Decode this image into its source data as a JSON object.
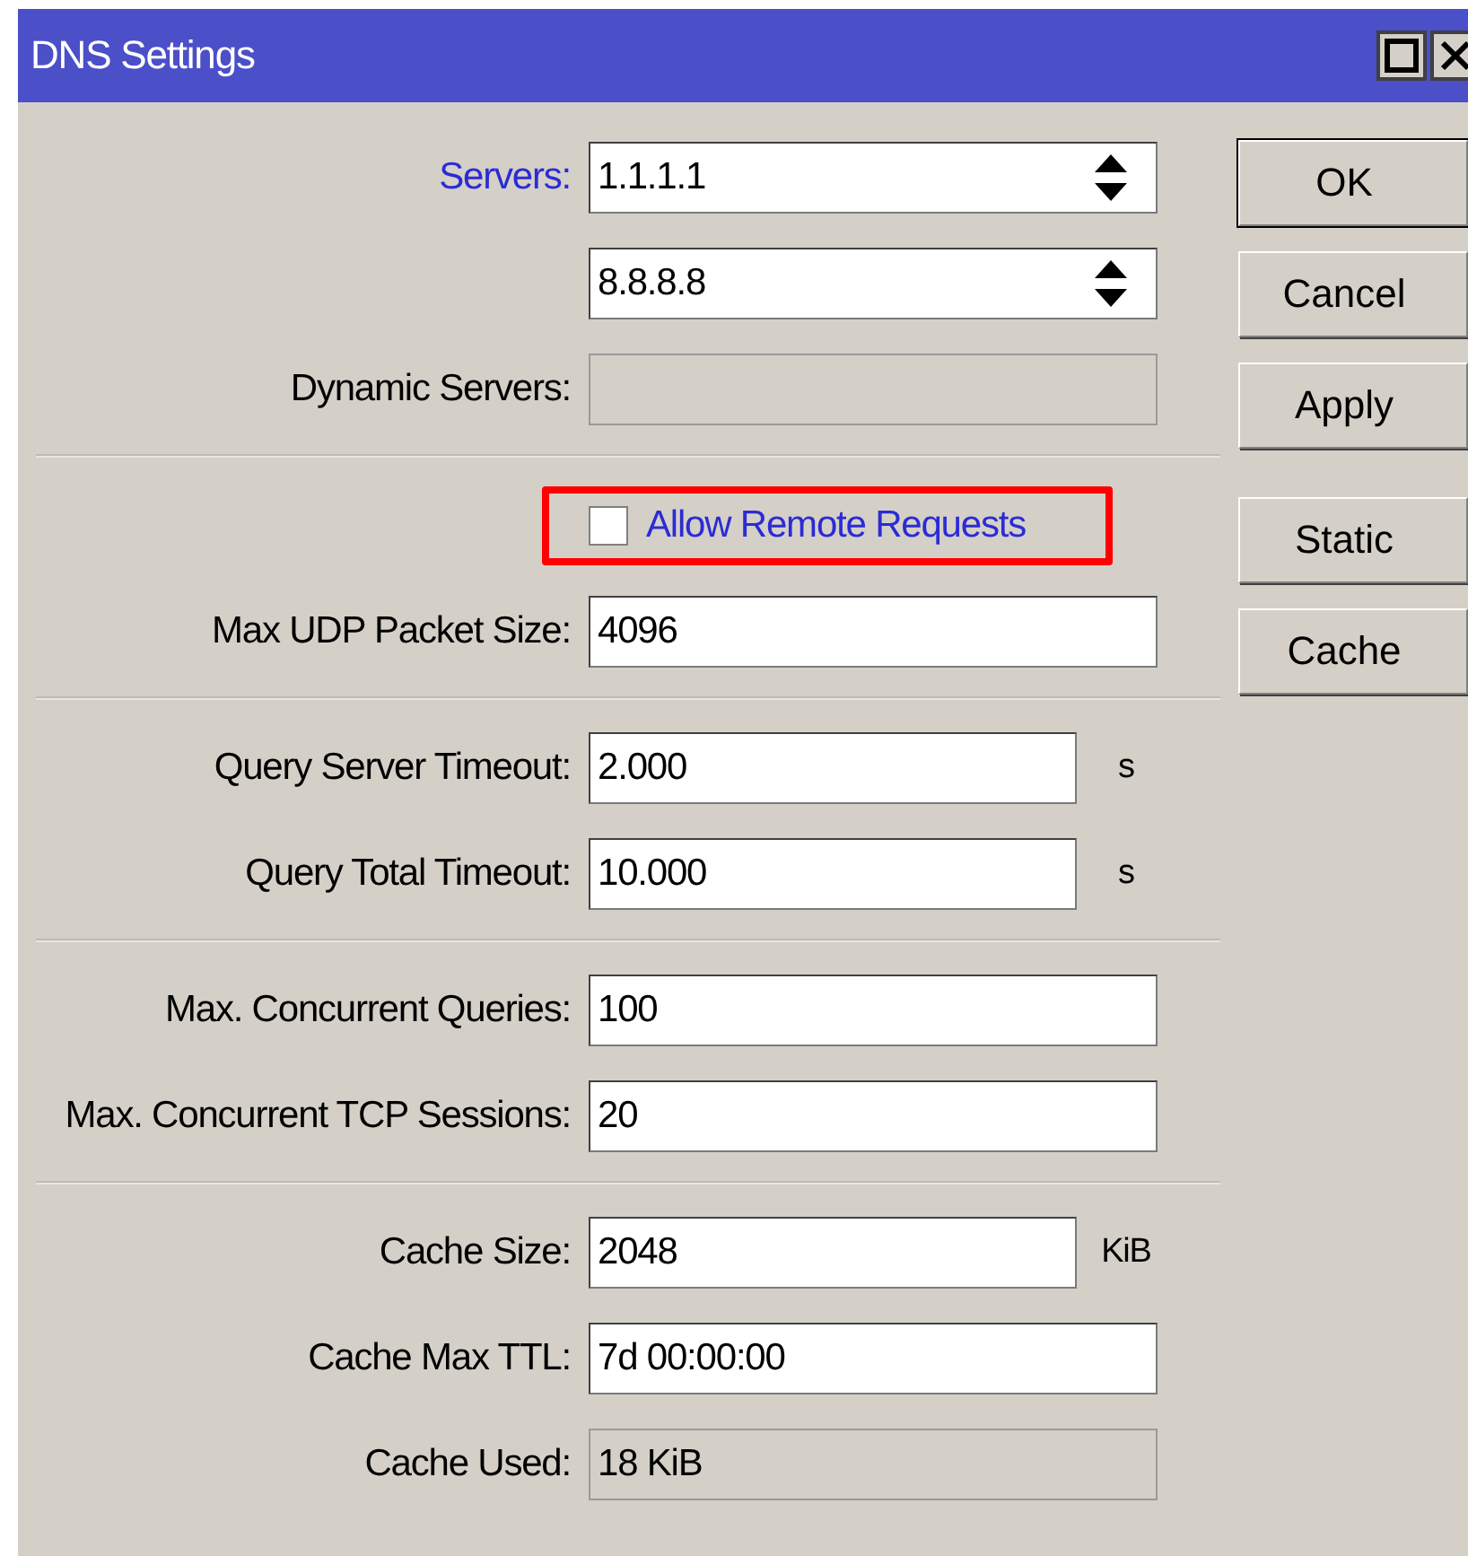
{
  "window": {
    "title": "DNS Settings"
  },
  "groups": [
    {
      "rows": [
        {
          "kind": "field",
          "label": "Servers:",
          "color": "#2b2bd6",
          "value": "1.1.1.1",
          "disabled": false,
          "spinner": true
        },
        {
          "kind": "field",
          "value": "8.8.8.8",
          "disabled": false,
          "spinner": true
        },
        {
          "kind": "field",
          "label": "Dynamic Servers:",
          "color": "#000000",
          "disabled": true,
          "spinner": false
        }
      ]
    },
    {
      "rows": [
        {
          "kind": "checkbox",
          "text": "Allow Remote Requests",
          "checked": false,
          "highlighted": true
        },
        {
          "kind": "field",
          "label": "Max UDP Packet Size:",
          "color": "#000000",
          "value": "4096",
          "disabled": false,
          "spinner": false
        }
      ]
    },
    {
      "rows": [
        {
          "kind": "short_field",
          "label": "Query Server Timeout:",
          "color": "#000000",
          "value": "2.000",
          "unit": "s",
          "disabled": false
        },
        {
          "kind": "short_field",
          "label": "Query Total Timeout:",
          "color": "#000000",
          "value": "10.000",
          "unit": "s",
          "disabled": false
        }
      ]
    },
    {
      "rows": [
        {
          "kind": "field",
          "label": "Max. Concurrent Queries:",
          "color": "#000000",
          "value": "100",
          "disabled": false,
          "spinner": false
        },
        {
          "kind": "field",
          "label": "Max. Concurrent TCP Sessions:",
          "color": "#000000",
          "value": "20",
          "disabled": false,
          "spinner": false
        }
      ]
    },
    {
      "rows": [
        {
          "kind": "short_field",
          "label": "Cache Size:",
          "color": "#000000",
          "value": "2048",
          "unit": "KiB",
          "disabled": false
        },
        {
          "kind": "field",
          "label": "Cache Max TTL:",
          "color": "#000000",
          "value": "7d 00:00:00",
          "disabled": false,
          "spinner": false
        },
        {
          "kind": "field",
          "label": "Cache Used:",
          "color": "#000000",
          "value": "18 KiB",
          "disabled": true,
          "spinner": false
        }
      ]
    }
  ],
  "button_groups": [
    {
      "buttons": [
        {
          "label": "OK",
          "default": true
        },
        {
          "label": "Cancel",
          "default": false
        },
        {
          "label": "Apply",
          "default": false
        }
      ]
    },
    {
      "buttons": [
        {
          "label": "Static",
          "default": false
        },
        {
          "label": "Cache",
          "default": false
        }
      ]
    }
  ]
}
